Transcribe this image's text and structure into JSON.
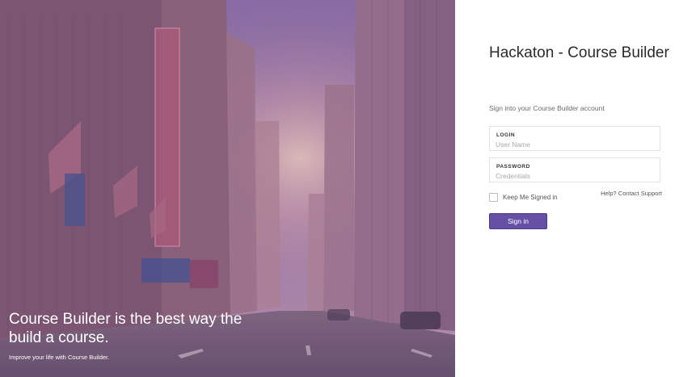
{
  "hero": {
    "headline": "Course Builder is the best way the build a course.",
    "tagline": "Improve your life with Course Builder."
  },
  "login": {
    "app_title": "Hackaton - Course Builder",
    "subtitle": "Sign into your Course Builder account",
    "username_label": "LOGIN",
    "username_placeholder": "User Name",
    "password_label": "PASSWORD",
    "password_placeholder": "Credentials",
    "remember_label": "Keep Me Signed in",
    "help_link": "Help? Contact Support",
    "signin_label": "Sign in"
  },
  "colors": {
    "accent": "#6650a6",
    "hero_overlay": "#8a6a9a"
  }
}
